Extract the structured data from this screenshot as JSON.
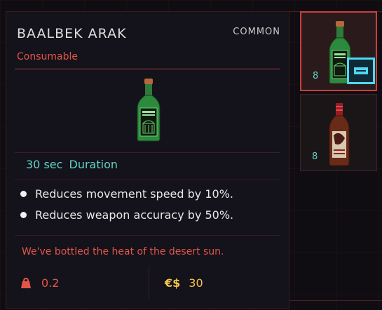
{
  "tooltip": {
    "title": "BAALBEK ARAK",
    "rarity": "COMMON",
    "type": "Consumable",
    "duration_value": "30 sec",
    "duration_label": "Duration",
    "effects": [
      "Reduces movement speed by 10%.",
      "Reduces weapon accuracy by 50%."
    ],
    "flavor_text": "We've bottled the heat of the desert sun.",
    "weight": "0.2",
    "price_currency": "€$",
    "price": "30"
  },
  "inventory": {
    "slots": [
      {
        "quantity": "8",
        "item": "green-bottle-icon",
        "selected": true,
        "equipped": true
      },
      {
        "quantity": "8",
        "item": "amber-bottle-icon",
        "selected": false,
        "equipped": false
      }
    ]
  },
  "colors": {
    "accent_red": "#e2564a",
    "accent_cyan": "#5fd3c5",
    "price_yellow": "#f3c64a",
    "equip_cyan": "#4fd8f0"
  }
}
